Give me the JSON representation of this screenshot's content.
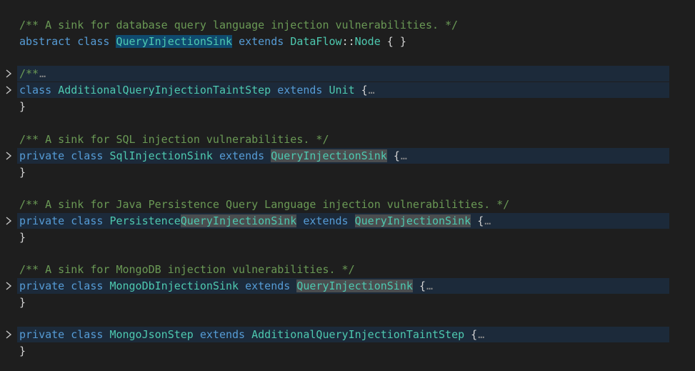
{
  "lines": {
    "l1": {
      "comment": "/** A sink for database query language injection vulnerabilities. */"
    },
    "l2": {
      "kw_abstract": "abstract",
      "kw_class": "class",
      "name": "QueryInjectionSink",
      "kw_extends": "extends",
      "super_ns": "DataFlow",
      "sep": "::",
      "super_name": "Node",
      "body": "{ }"
    },
    "l4": {
      "comment": "/**",
      "ellipsis": "…"
    },
    "l5": {
      "kw_class": "class",
      "name": "AdditionalQueryInjectionTaintStep",
      "kw_extends": "extends",
      "super": "Unit",
      "brace": "{",
      "ellipsis": "…"
    },
    "l6": {
      "close": "}"
    },
    "l8": {
      "comment": "/** A sink for SQL injection vulnerabilities. */"
    },
    "l9": {
      "kw_private": "private",
      "kw_class": "class",
      "name": "SqlInjectionSink",
      "kw_extends": "extends",
      "super": "QueryInjectionSink",
      "brace": "{",
      "ellipsis": "…"
    },
    "l10": {
      "close": "}"
    },
    "l12": {
      "comment": "/** A sink for Java Persistence Query Language injection vulnerabilities. */"
    },
    "l13": {
      "kw_private": "private",
      "kw_class": "class",
      "name_prefix": "Persistence",
      "name_match": "QueryInjectionSink",
      "kw_extends": "extends",
      "super": "QueryInjectionSink",
      "brace": "{",
      "ellipsis": "…"
    },
    "l14": {
      "close": "}"
    },
    "l16": {
      "comment": "/** A sink for MongoDB injection vulnerabilities. */"
    },
    "l17": {
      "kw_private": "private",
      "kw_class": "class",
      "name": "MongoDbInjectionSink",
      "kw_extends": "extends",
      "super": "QueryInjectionSink",
      "brace": "{",
      "ellipsis": "…"
    },
    "l18": {
      "close": "}"
    },
    "l20": {
      "kw_private": "private",
      "kw_class": "class",
      "name": "MongoJsonStep",
      "kw_extends": "extends",
      "super": "AdditionalQueryInjectionTaintStep",
      "brace": "{",
      "ellipsis": "…"
    },
    "l21": {
      "close": "}"
    }
  },
  "icons": {
    "fold": "chevron-right-icon"
  },
  "colors": {
    "background": "#1e1e1e",
    "comment": "#6a9955",
    "keyword": "#569cd6",
    "type": "#4ec9b0",
    "selection_highlight": "#0f4a6e",
    "occurrence_highlight": "#4a4d4f",
    "folded_line_background": "#1c2a3a"
  }
}
